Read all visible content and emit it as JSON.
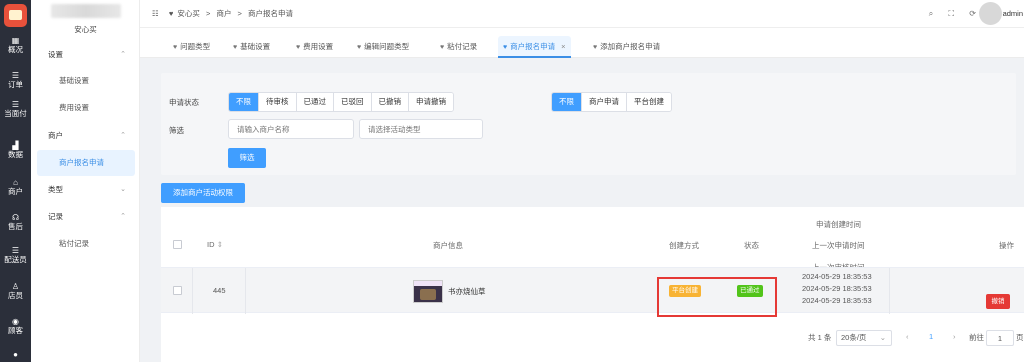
{
  "rail": {
    "items": [
      {
        "icon": "▦",
        "label": "概况"
      },
      {
        "icon": "☰",
        "label": "订单"
      },
      {
        "icon": "☰",
        "label": "当面付"
      },
      {
        "icon": "▟",
        "label": "数据"
      },
      {
        "icon": "⌂",
        "label": "商户"
      },
      {
        "icon": "☊",
        "label": "售后"
      },
      {
        "icon": "☰",
        "label": "配送员"
      },
      {
        "icon": "♙",
        "label": "店员"
      },
      {
        "icon": "◉",
        "label": "顾客"
      },
      {
        "icon": "●",
        "label": ""
      }
    ]
  },
  "sidebar": {
    "shop_name": "安心买",
    "items": [
      {
        "label": "设置",
        "type": "group",
        "arrow": "⌃"
      },
      {
        "label": "基础设置",
        "type": "sub"
      },
      {
        "label": "费用设置",
        "type": "sub"
      },
      {
        "label": "商户",
        "type": "group",
        "arrow": "⌃"
      },
      {
        "label": "商户报名申请",
        "type": "active"
      },
      {
        "label": "类型",
        "type": "group",
        "arrow": "⌄"
      },
      {
        "label": "记录",
        "type": "group",
        "arrow": "⌃"
      },
      {
        "label": "粘付记录",
        "type": "sub"
      }
    ]
  },
  "topbar": {
    "menu_icon": "☷",
    "breadcrumb": [
      "安心买",
      ">",
      "商户",
      ">",
      "商户报名申请"
    ],
    "icons": [
      "⌕",
      "⛶",
      "⟳"
    ],
    "user": "admin"
  },
  "tabs": [
    {
      "label": "问题类型"
    },
    {
      "label": "基础设置"
    },
    {
      "label": "费用设置"
    },
    {
      "label": "编辑问题类型"
    },
    {
      "label": "粘付记录"
    },
    {
      "label": "商户报名申请",
      "active": true,
      "close": "×"
    },
    {
      "label": "添加商户报名申请"
    }
  ],
  "filter": {
    "status_label": "申请状态",
    "status_options": [
      "不限",
      "待审核",
      "已通过",
      "已驳回",
      "已撤销",
      "申请撤销"
    ],
    "source_options": [
      "不限",
      "商户申请",
      "平台创建"
    ],
    "filter_label": "筛选",
    "merchant_placeholder": "请输入商户名称",
    "activity_placeholder": "请选择活动类型",
    "search_button": "筛选"
  },
  "add_button": "添加商户活动权限",
  "table": {
    "headers": {
      "id": "ID",
      "sort_icon": "⇕",
      "merchant": "商户信息",
      "method": "创建方式",
      "status": "状态",
      "time1": "申请创建时间",
      "time2": "上一次申请时间",
      "time3": "上一次审核时间",
      "action": "操作"
    },
    "rows": [
      {
        "id": "445",
        "merchant_name": "书亦烧仙草",
        "method": "平台创建",
        "status": "已通过",
        "times": [
          "2024-05-29 18:35:53",
          "2024-05-29 18:35:53",
          "2024-05-29 18:35:53"
        ],
        "action": "撤销"
      }
    ]
  },
  "pagination": {
    "total": "共 1 条",
    "page_size": "20条/页",
    "page_size_arrow": "⌄",
    "prev": "‹",
    "current": "1",
    "next": "›",
    "goto_label": "前往",
    "goto_value": "1",
    "page_unit": "页"
  },
  "colors": {
    "accent": "#409eff",
    "danger": "#e53935",
    "warning": "#f8b334",
    "success": "#52c41a"
  }
}
